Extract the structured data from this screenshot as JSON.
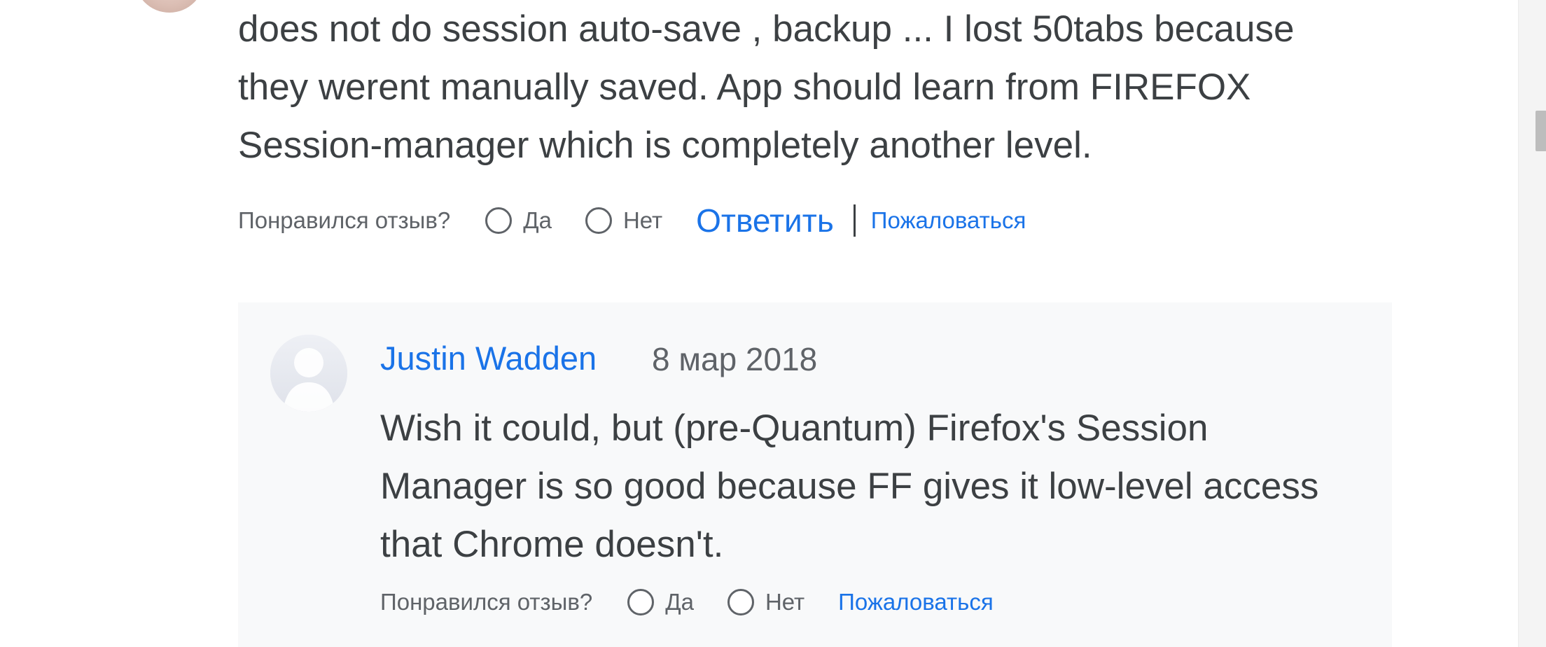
{
  "review": {
    "text": "does not do session auto-save , backup ... I lost 50tabs because they werent manually saved. App should learn from FIREFOX Session-manager which is completely another level.",
    "feedback": {
      "question": "Понравился отзыв?",
      "yes_label": "Да",
      "no_label": "Нет",
      "reply_label": "Ответить",
      "report_label": "Пожаловаться"
    }
  },
  "reply": {
    "author": "Justin Wadden",
    "date": "8 мар 2018",
    "text": "Wish it could, but (pre-Quantum) Firefox's Session Manager is so good because FF gives it low-level access that Chrome doesn't.",
    "feedback": {
      "question": "Понравился отзыв?",
      "yes_label": "Да",
      "no_label": "Нет",
      "report_label": "Пожаловаться"
    }
  },
  "colors": {
    "link": "#1a73e8",
    "text": "#3c4043",
    "muted": "#5f6368",
    "reply_background": "#f8f9fa"
  }
}
